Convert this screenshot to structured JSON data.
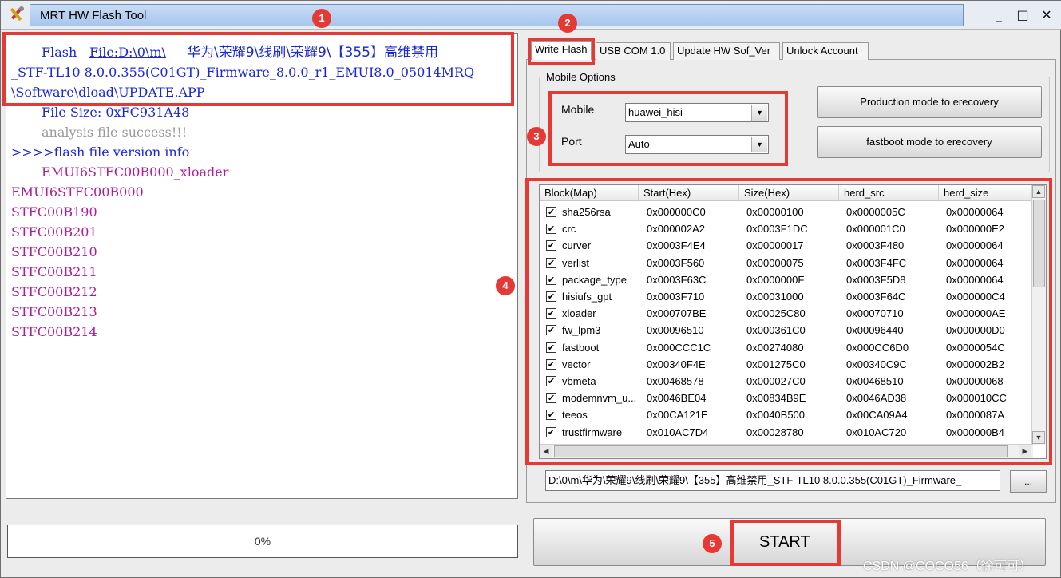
{
  "window": {
    "title": "MRT HW Flash Tool",
    "min": "_",
    "max": "□",
    "close": "✕"
  },
  "log": {
    "lines": [
      {
        "text": "Flash ",
        "color": "blue"
      },
      {
        "text": "File:D:\\0\\m\\",
        "color": "link"
      },
      {
        "text": "华为\\荣耀9\\线刷\\荣耀9\\【355】高维禁用",
        "color": "blue"
      },
      {
        "text": "_STF-TL10 8.0.0.355(C01GT)_Firmware_8.0.0_r1_EMUI8.0_05014MRQ",
        "color": "blue"
      },
      {
        "text": "\\Software\\dload\\UPDATE.APP",
        "color": "blue"
      },
      {
        "text": "File Size: 0xFC931A48",
        "color": "blue"
      },
      {
        "text": "analysis file success!!!",
        "color": "gray"
      },
      {
        "text": ">>>>flash file version info",
        "color": "blue"
      },
      {
        "text": "EMUI6STFC00B000_xloader",
        "color": "magenta"
      },
      {
        "text": "EMUI6STFC00B000",
        "color": "magenta"
      },
      {
        "text": "STFC00B190",
        "color": "magenta"
      },
      {
        "text": "STFC00B201",
        "color": "magenta"
      },
      {
        "text": "STFC00B210",
        "color": "magenta"
      },
      {
        "text": "STFC00B211",
        "color": "magenta"
      },
      {
        "text": "STFC00B212",
        "color": "magenta"
      },
      {
        "text": "STFC00B213",
        "color": "magenta"
      },
      {
        "text": "STFC00B214",
        "color": "magenta"
      }
    ]
  },
  "progress": {
    "label": "0%",
    "value": 0
  },
  "tabs": [
    "Write Flash",
    "USB COM 1.0",
    "Update HW Sof_Ver",
    "Unlock Account"
  ],
  "mobile_options": {
    "group_title": "Mobile Options",
    "mobile_label": "Mobile",
    "mobile_value": "huawei_hisi",
    "port_label": "Port",
    "port_value": "Auto",
    "btn_production": "Production mode to erecovery",
    "btn_fastboot": "fastboot mode to erecovery"
  },
  "table": {
    "columns": [
      "Block(Map)",
      "Start(Hex)",
      "Size(Hex)",
      "herd_src",
      "herd_size"
    ],
    "rows": [
      [
        "sha256rsa",
        "0x000000C0",
        "0x00000100",
        "0x0000005C",
        "0x00000064"
      ],
      [
        "crc",
        "0x000002A2",
        "0x0003F1DC",
        "0x000001C0",
        "0x000000E2"
      ],
      [
        "curver",
        "0x0003F4E4",
        "0x00000017",
        "0x0003F480",
        "0x00000064"
      ],
      [
        "verlist",
        "0x0003F560",
        "0x00000075",
        "0x0003F4FC",
        "0x00000064"
      ],
      [
        "package_type",
        "0x0003F63C",
        "0x0000000F",
        "0x0003F5D8",
        "0x00000064"
      ],
      [
        "hisiufs_gpt",
        "0x0003F710",
        "0x00031000",
        "0x0003F64C",
        "0x000000C4"
      ],
      [
        "xloader",
        "0x000707BE",
        "0x00025C80",
        "0x00070710",
        "0x000000AE"
      ],
      [
        "fw_lpm3",
        "0x00096510",
        "0x000361C0",
        "0x00096440",
        "0x000000D0"
      ],
      [
        "fastboot",
        "0x000CCC1C",
        "0x00274080",
        "0x000CC6D0",
        "0x0000054C"
      ],
      [
        "vector",
        "0x00340F4E",
        "0x001275C0",
        "0x00340C9C",
        "0x000002B2"
      ],
      [
        "vbmeta",
        "0x00468578",
        "0x000027C0",
        "0x00468510",
        "0x00000068"
      ],
      [
        "modemnvm_u...",
        "0x0046BE04",
        "0x00834B9E",
        "0x0046AD38",
        "0x000010CC"
      ],
      [
        "teeos",
        "0x00CA121E",
        "0x0040B500",
        "0x00CA09A4",
        "0x0000087A"
      ],
      [
        "trustfirmware",
        "0x010AC7D4",
        "0x00028780",
        "0x010AC720",
        "0x000000B4"
      ]
    ],
    "checkmark": "✔"
  },
  "path_value": "D:\\0\\m\\华为\\荣耀9\\线刷\\荣耀9\\【355】高维禁用_STF-TL10 8.0.0.355(C01GT)_Firmware_",
  "browse_label": "...",
  "start_label": "START",
  "watermark": "CSDN @COCO56（徐可可）",
  "badges": [
    "1",
    "2",
    "3",
    "4",
    "5"
  ],
  "colors": {
    "annotation": "#e53935",
    "log_blue": "#1a27d6",
    "log_magenta": "#b0199d",
    "log_gray": "#9a9a9a"
  }
}
